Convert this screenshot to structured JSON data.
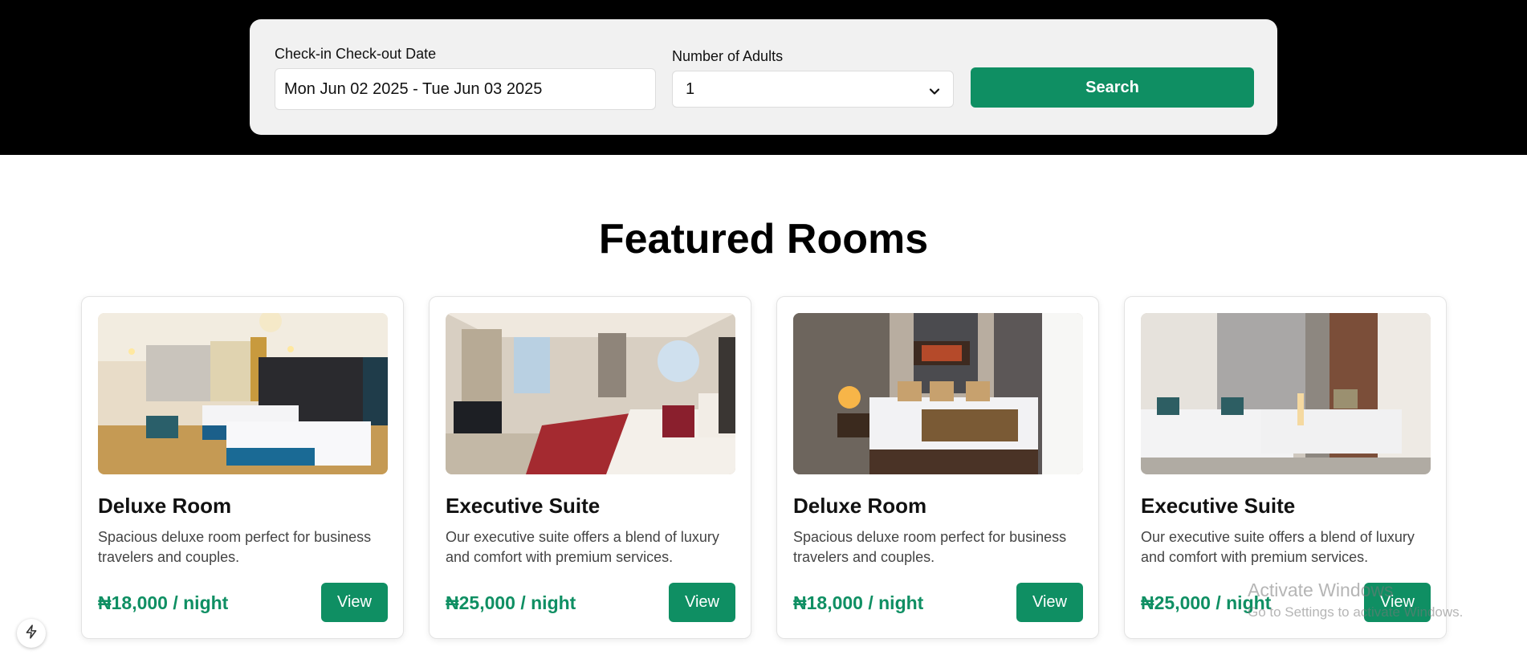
{
  "search": {
    "date_label": "Check-in Check-out Date",
    "date_value": "Mon Jun 02 2025 - Tue Jun 03 2025",
    "adults_label": "Number of Adults",
    "adults_value": "1",
    "search_button": "Search"
  },
  "featured": {
    "title": "Featured Rooms",
    "rooms": [
      {
        "name": "Deluxe Room",
        "description": "Spacious deluxe room perfect for business travelers and couples.",
        "price": "₦18,000 / night",
        "button": "View"
      },
      {
        "name": "Executive Suite",
        "description": "Our executive suite offers a blend of luxury and comfort with premium services.",
        "price": "₦25,000 / night",
        "button": "View"
      },
      {
        "name": "Deluxe Room",
        "description": "Spacious deluxe room perfect for business travelers and couples.",
        "price": "₦18,000 / night",
        "button": "View"
      },
      {
        "name": "Executive Suite",
        "description": "Our executive suite offers a blend of luxury and comfort with premium services.",
        "price": "₦25,000 / night",
        "button": "View"
      }
    ]
  },
  "watermark": {
    "title": "Activate Windows",
    "subtitle": "Go to Settings to activate Windows."
  },
  "icons": {
    "dev_tools": "lightning-icon",
    "select": "chevron-down-icon"
  },
  "colors": {
    "accent": "#0f8f63",
    "hero_background": "#000000",
    "search_panel": "#f1f1f1"
  }
}
